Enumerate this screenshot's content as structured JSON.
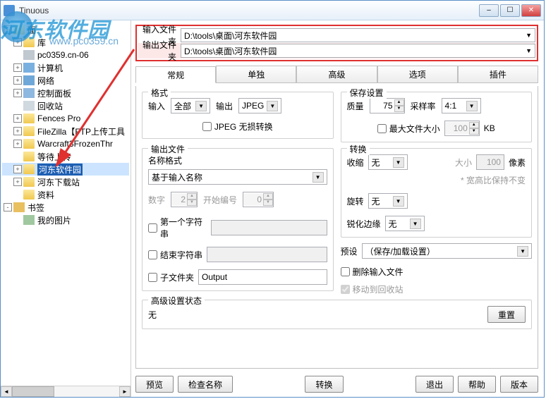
{
  "window": {
    "title": "Tinuous"
  },
  "win_btns": {
    "min": "–",
    "max": "☐",
    "close": "✕"
  },
  "watermark": {
    "text": "河东软件园",
    "sub": "www.pc0359.cn"
  },
  "paths": {
    "in_label": "输入文件夹",
    "in_value": "D:\\tools\\桌面\\河东软件园",
    "out_label": "输出文件夹",
    "out_value": "D:\\tools\\桌面\\河东软件园"
  },
  "tree": [
    {
      "label": "面",
      "indent": 1,
      "exp": "-",
      "icon": "folder-icon"
    },
    {
      "label": "库",
      "indent": 2,
      "exp": "+",
      "icon": "folder-icon"
    },
    {
      "label": "pc0359.cn-06",
      "indent": 2,
      "exp": "",
      "icon": "drive-icon"
    },
    {
      "label": "计算机",
      "indent": 2,
      "exp": "+",
      "icon": "computer-icon"
    },
    {
      "label": "网络",
      "indent": 2,
      "exp": "+",
      "icon": "network-icon"
    },
    {
      "label": "控制面板",
      "indent": 2,
      "exp": "+",
      "icon": "panel-icon"
    },
    {
      "label": "回收站",
      "indent": 2,
      "exp": "",
      "icon": "recycle-icon"
    },
    {
      "label": "Fences Pro",
      "indent": 2,
      "exp": "+",
      "icon": "folder-icon"
    },
    {
      "label": "FileZilla【FTP上传工具",
      "indent": 2,
      "exp": "+",
      "icon": "folder-icon"
    },
    {
      "label": "Warcraft3FrozenThr",
      "indent": 2,
      "exp": "+",
      "icon": "folder-icon"
    },
    {
      "label": "等待上传",
      "indent": 2,
      "exp": "",
      "icon": "folder-icon"
    },
    {
      "label": "河东软件园",
      "indent": 2,
      "exp": "+",
      "icon": "folder-icon",
      "selected": true
    },
    {
      "label": "河东下载站",
      "indent": 2,
      "exp": "+",
      "icon": "folder-icon"
    },
    {
      "label": "资料",
      "indent": 2,
      "exp": "",
      "icon": "folder-icon"
    },
    {
      "label": "书签",
      "indent": 1,
      "exp": "-",
      "icon": "bookmark-icon"
    },
    {
      "label": "我的图片",
      "indent": 2,
      "exp": "",
      "icon": "picture-icon"
    }
  ],
  "tabs": [
    "常规",
    "单独",
    "高级",
    "选项",
    "插件"
  ],
  "format": {
    "title": "格式",
    "in_label": "输入",
    "in_value": "全部",
    "out_label": "输出",
    "out_value": "JPEG",
    "lossless": "JPEG 无损转换"
  },
  "save": {
    "title": "保存设置",
    "quality_label": "质量",
    "quality_value": "75",
    "sample_label": "采样率",
    "sample_value": "4:1",
    "maxfile": "最大文件大小",
    "maxfile_value": "100",
    "maxfile_unit": "KB"
  },
  "output": {
    "title": "输出文件",
    "name_format_label": "名称格式",
    "name_format_value": "基于输入名称",
    "digits_label": "数字",
    "digits_value": "2",
    "start_label": "开始编号",
    "start_value": "0",
    "first_char": "第一个字符串",
    "end_char": "结束字符串",
    "subfolder": "子文件夹",
    "subfolder_value": "Output"
  },
  "transform": {
    "title": "转换",
    "shrink_label": "收缩",
    "shrink_value": "无",
    "size_label": "大小",
    "size_value": "100",
    "size_unit": "像素",
    "aspect": "* 宽高比保持不变",
    "rotate_label": "旋转",
    "rotate_value": "无",
    "sharpen_label": "锐化边缘",
    "sharpen_value": "无"
  },
  "preset": {
    "label": "预设",
    "value": "（保存/加载设置）"
  },
  "delete": {
    "delete_input": "删除输入文件",
    "move_recycle": "移动到回收站"
  },
  "advstate": {
    "title": "高级设置状态",
    "value": "无",
    "reset": "重置"
  },
  "footer": {
    "preview": "预览",
    "check": "检查名称",
    "convert": "转换",
    "exit": "退出",
    "help": "帮助",
    "version": "版本"
  }
}
